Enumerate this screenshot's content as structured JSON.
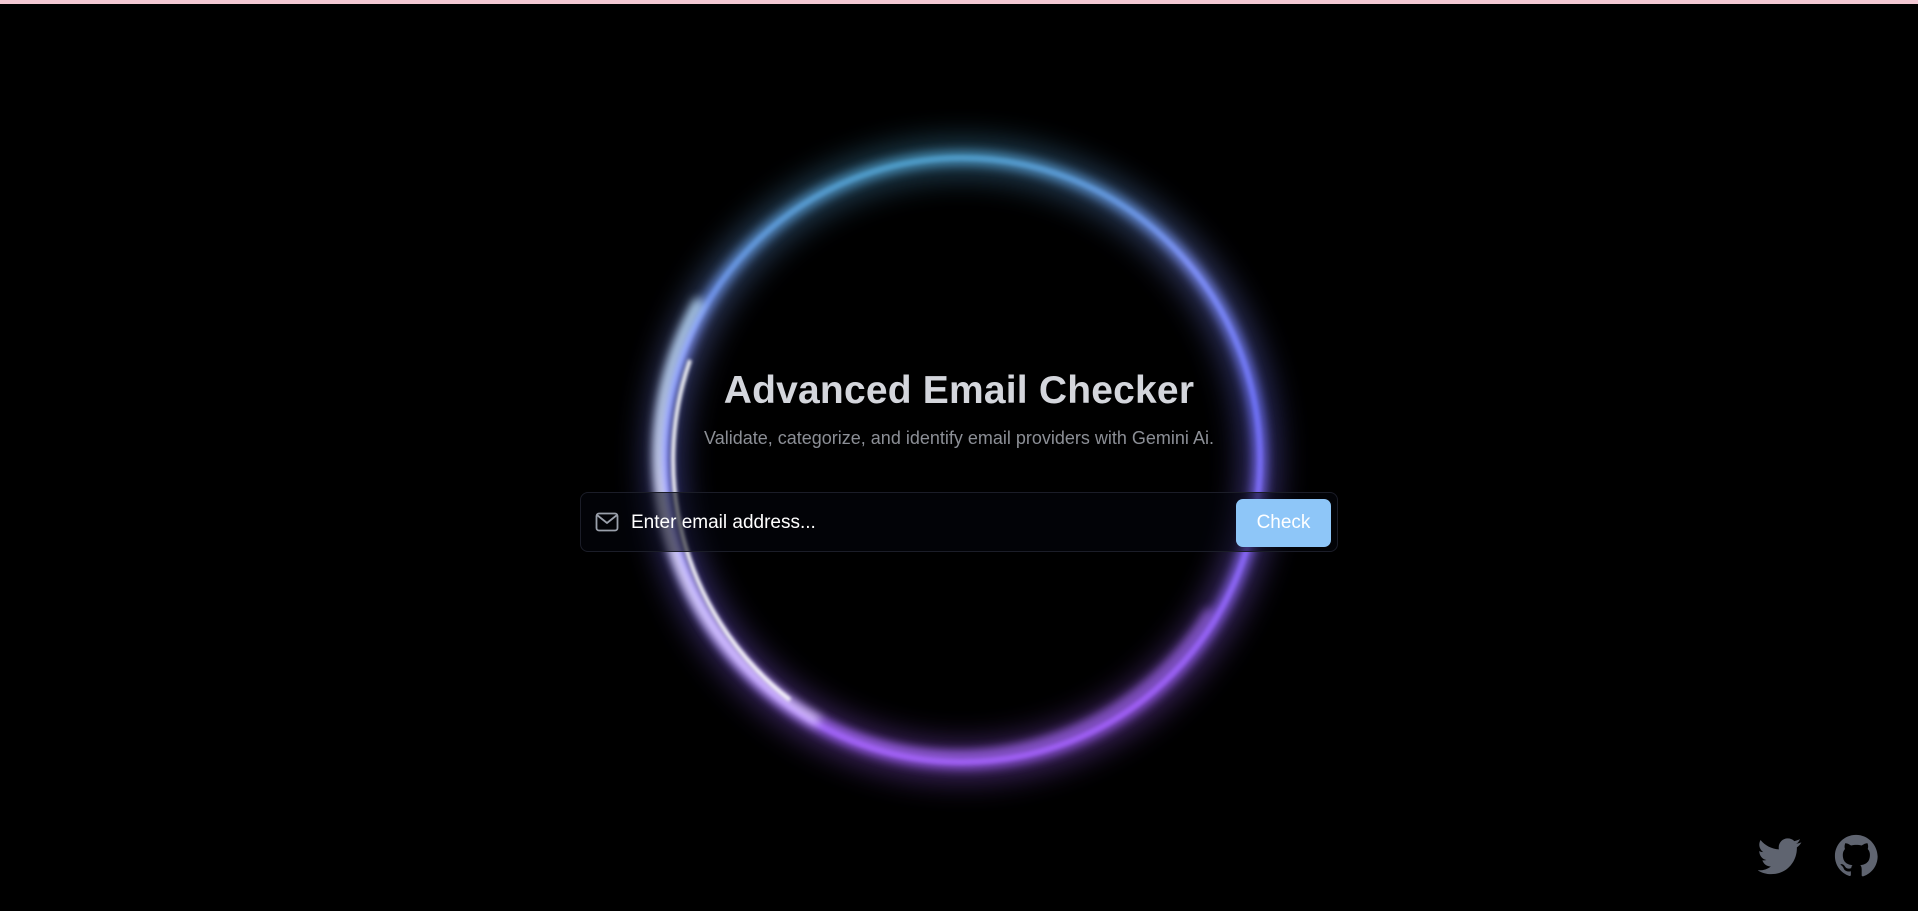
{
  "hero": {
    "title": "Advanced Email Checker",
    "subtitle": "Validate, categorize, and identify email providers with Gemini Ai."
  },
  "form": {
    "email_placeholder": "Enter email address...",
    "email_value": "",
    "check_label": "Check",
    "mail_icon": "mail-icon"
  },
  "footer": {
    "links": [
      {
        "name": "twitter",
        "icon": "twitter-icon"
      },
      {
        "name": "github",
        "icon": "github-icon"
      }
    ]
  },
  "colors": {
    "background": "#000000",
    "accent_button": "#8ec6f8",
    "ring_top": "#3f9db8",
    "ring_left": "#e8f0ff",
    "ring_bottom": "#9b5cf0",
    "icon_gray": "#5f6470"
  }
}
